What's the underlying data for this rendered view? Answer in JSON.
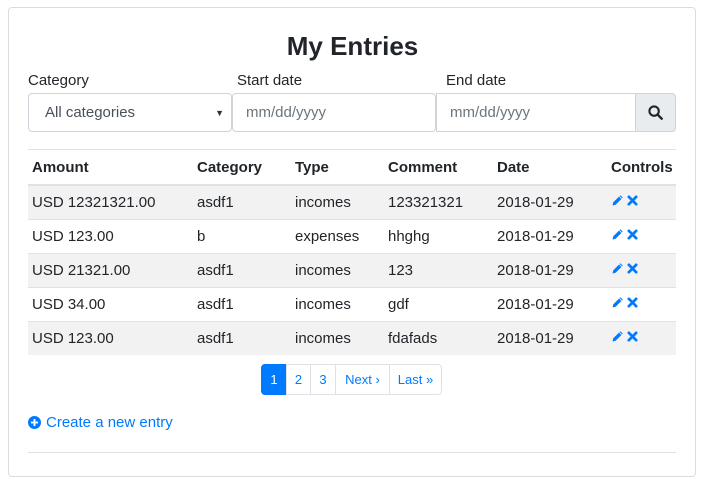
{
  "page": {
    "title": "My Entries"
  },
  "filters": {
    "category_label": "Category",
    "category_value": "All categories",
    "start_label": "Start date",
    "start_placeholder": "mm/dd/yyyy",
    "end_label": "End date",
    "end_placeholder": "mm/dd/yyyy",
    "search_icon": "search-icon"
  },
  "table": {
    "headers": [
      "Amount",
      "Category",
      "Type",
      "Comment",
      "Date",
      "Controls"
    ],
    "rows": [
      {
        "amount": "USD 12321321.00",
        "category": "asdf1",
        "type": "incomes",
        "comment": "123321321",
        "date": "2018-01-29"
      },
      {
        "amount": "USD 123.00",
        "category": "b",
        "type": "expenses",
        "comment": "hhghg",
        "date": "2018-01-29"
      },
      {
        "amount": "USD 21321.00",
        "category": "asdf1",
        "type": "incomes",
        "comment": "123",
        "date": "2018-01-29"
      },
      {
        "amount": "USD 34.00",
        "category": "asdf1",
        "type": "incomes",
        "comment": "gdf",
        "date": "2018-01-29"
      },
      {
        "amount": "USD 123.00",
        "category": "asdf1",
        "type": "incomes",
        "comment": "fdafads",
        "date": "2018-01-29"
      }
    ],
    "control_icons": [
      "pencil-icon",
      "close-icon"
    ]
  },
  "pagination": {
    "pages": [
      "1",
      "2",
      "3"
    ],
    "next": "Next ›",
    "last": "Last »",
    "active": "1"
  },
  "actions": {
    "create_label": "Create a new entry",
    "create_icon": "plus-circle-icon"
  },
  "colors": {
    "accent": "#007bff",
    "stripe": "#f2f2f2",
    "border": "#dee2e6"
  }
}
